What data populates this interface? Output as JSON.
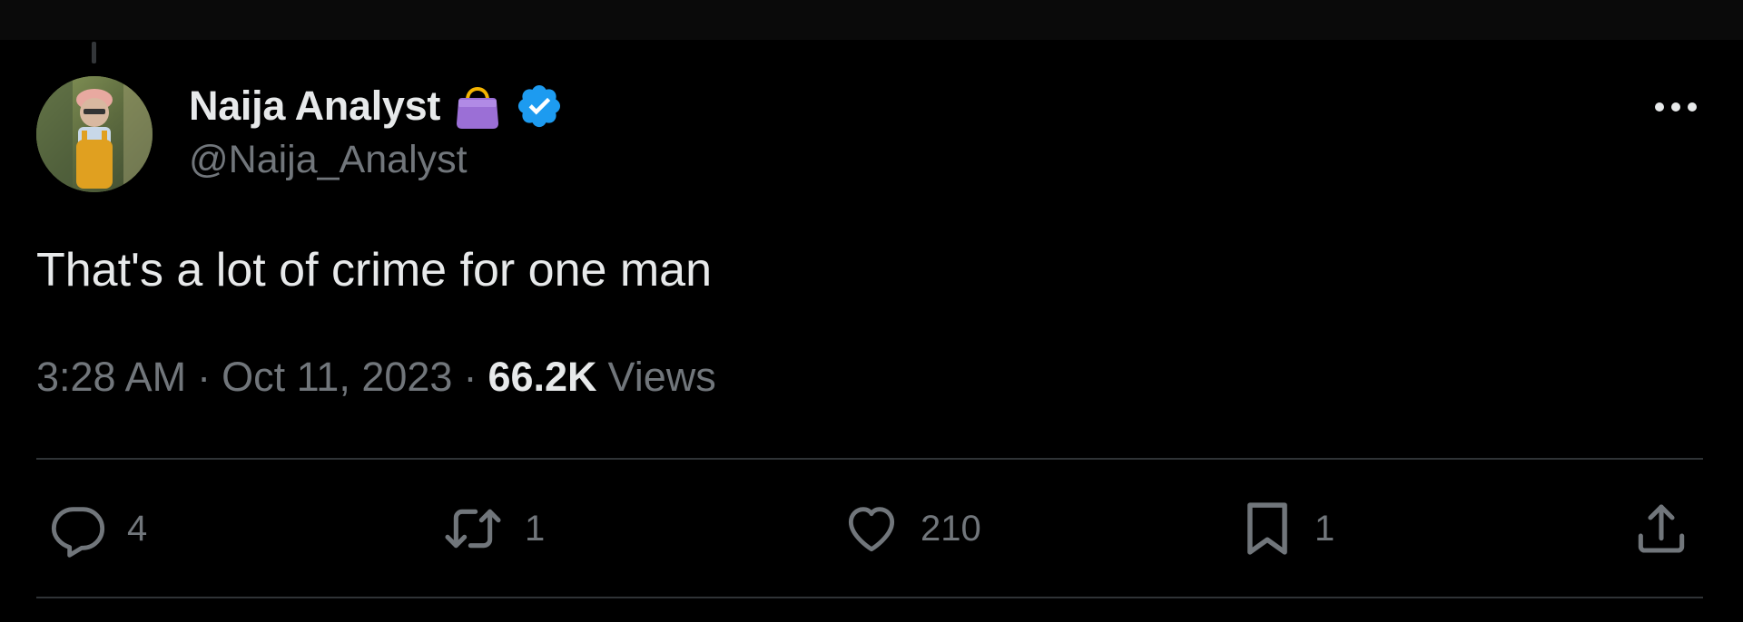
{
  "author": {
    "display_name": "Naija Analyst",
    "handle": "@Naija_Analyst",
    "badge_icon": "purse-emoji-icon",
    "verified_icon": "verified-badge-icon",
    "verified_color": "#1d9bf0"
  },
  "tweet": {
    "text": "That's a lot of crime for one man",
    "time": "3:28 AM",
    "date": "Oct 11, 2023",
    "separator": "·",
    "views_count": "66.2K",
    "views_label": "Views"
  },
  "actions": {
    "reply_count": "4",
    "retweet_count": "1",
    "like_count": "210",
    "bookmark_count": "1"
  },
  "colors": {
    "background": "#000000",
    "primary_text": "#e7e9ea",
    "secondary_text": "#71767b",
    "divider": "#2f3336"
  }
}
